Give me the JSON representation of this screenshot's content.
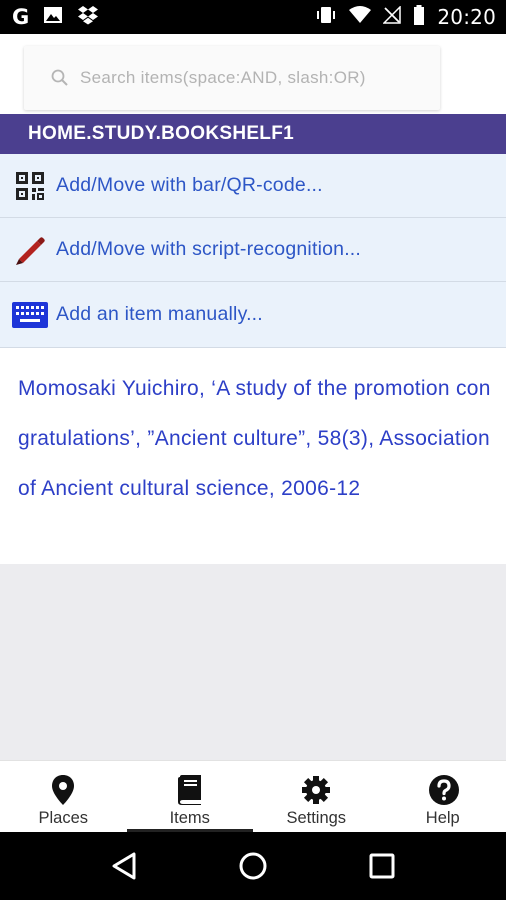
{
  "status_bar": {
    "time": "20:20",
    "left_icons": [
      "google-icon",
      "image-icon",
      "dropbox-icon"
    ],
    "right_icons": [
      "vibrate-icon",
      "wifi-icon",
      "no-signal-icon",
      "battery-icon"
    ]
  },
  "search": {
    "placeholder": "Search items(space:AND, slash:OR)"
  },
  "path_header": "HOME.STUDY.BOOKSHELF1",
  "actions": [
    {
      "label": "Add/Move with bar/QR-code...",
      "icon": "qr-code-icon"
    },
    {
      "label": "Add/Move with script-recognition...",
      "icon": "pencil-icon"
    },
    {
      "label": "Add an item manually...",
      "icon": "keyboard-icon"
    }
  ],
  "items": [
    {
      "text": "Momosaki Yuichiro, ‘A study of the promotion congratulations’, ”Ancient culture”, 58(3), Association of Ancient cultural science, 2006-12"
    }
  ],
  "bottom_nav": [
    {
      "label": "Places",
      "icon": "map-pin-icon",
      "active": false
    },
    {
      "label": "Items",
      "icon": "book-icon",
      "active": true
    },
    {
      "label": "Settings",
      "icon": "gear-icon",
      "active": false
    },
    {
      "label": "Help",
      "icon": "help-icon",
      "active": false
    }
  ],
  "colors": {
    "header_bg": "#4b3f8f",
    "action_bg": "#eaf2fb",
    "action_text": "#2d56c6",
    "item_text": "#2d3fc7"
  }
}
